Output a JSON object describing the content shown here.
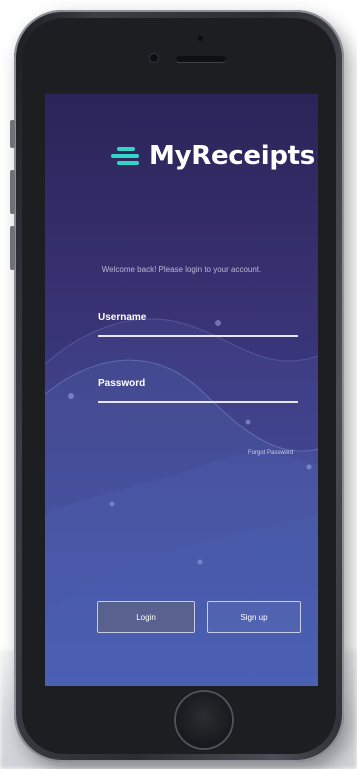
{
  "app": {
    "name": "MyReceipts",
    "logo_icon": "menu-lines-icon",
    "accent_color": "#32d6c6"
  },
  "login": {
    "welcome_text": "Welcome back! Please login to your account.",
    "username_label": "Username",
    "password_label": "Password",
    "forgot_password": "Forgot Password",
    "login_button": "Login",
    "signup_button": "Sign up"
  }
}
